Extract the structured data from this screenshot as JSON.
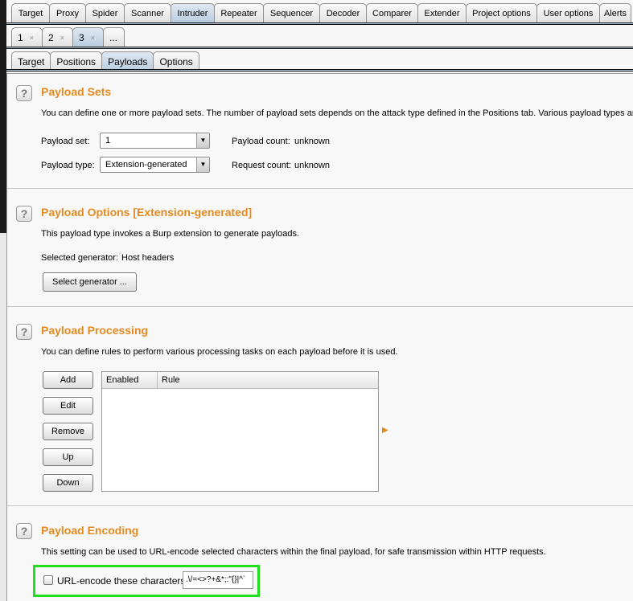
{
  "main_tabs": [
    "Target",
    "Proxy",
    "Spider",
    "Scanner",
    "Intruder",
    "Repeater",
    "Sequencer",
    "Decoder",
    "Comparer",
    "Extender",
    "Project options",
    "User options",
    "Alerts"
  ],
  "main_selected": "Intruder",
  "attack_tabs": [
    {
      "label": "1",
      "close": "×"
    },
    {
      "label": "2",
      "close": "×"
    },
    {
      "label": "3",
      "close": "×"
    },
    {
      "label": "..."
    }
  ],
  "sub_tabs": [
    "Target",
    "Positions",
    "Payloads",
    "Options"
  ],
  "help_glyph": "?",
  "payload_sets": {
    "title": "Payload Sets",
    "desc": "You can define one or more payload sets. The number of payload sets depends on the attack type defined in the Positions tab. Various payload types are",
    "set_label": "Payload set:",
    "set_value": "1",
    "type_label": "Payload type:",
    "type_value": "Extension-generated",
    "count_label": "Payload count:",
    "count_value": "unknown",
    "req_label": "Request count:",
    "req_value": "unknown"
  },
  "payload_options": {
    "title": "Payload Options [Extension-generated]",
    "desc": "This payload type invokes a Burp extension to generate payloads.",
    "gen_label": "Selected generator:",
    "gen_value": "Host headers",
    "select_btn": "Select generator ..."
  },
  "payload_processing": {
    "title": "Payload Processing",
    "desc": "You can define rules to perform various processing tasks on each payload before it is used.",
    "buttons": [
      "Add",
      "Edit",
      "Remove",
      "Up",
      "Down"
    ],
    "columns": [
      "Enabled",
      "Rule"
    ]
  },
  "payload_encoding": {
    "title": "Payload Encoding",
    "desc": "This setting can be used to URL-encode selected characters within the final payload, for safe transmission within HTTP requests.",
    "checkbox_label": "URL-encode these characters:",
    "checked": false,
    "chars": ".\\/=<>?+&*;:\"{}|^`"
  },
  "colors": {
    "heading": "#e58a1f",
    "highlight": "#22dd22",
    "tab_selected": "#b9cde0"
  }
}
